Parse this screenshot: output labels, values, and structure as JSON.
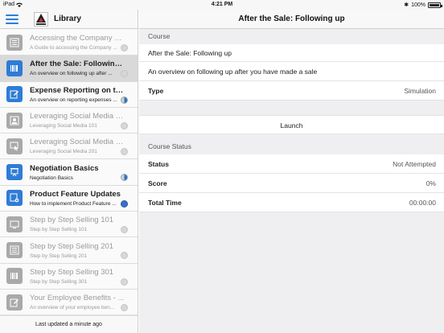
{
  "status_bar": {
    "carrier": "iPad",
    "time": "4:21 PM",
    "battery": "100%"
  },
  "sidebar": {
    "title": "Library",
    "footer": "Last updated a minute ago",
    "items": [
      {
        "title": "Accessing the Company Be...",
        "subtitle": "A Guide to accessing the Company ...",
        "icon": "document-list-icon",
        "dim": true,
        "status": "empty"
      },
      {
        "title": "After the Sale: Following up",
        "subtitle": "An overview on following up after ...",
        "icon": "barcode-icon",
        "dim": false,
        "selected": true,
        "status": "empty"
      },
      {
        "title": "Expense Reporting on the ...",
        "subtitle": "An overview on reporting expenses ...",
        "icon": "pencil-note-icon",
        "dim": false,
        "status": "half"
      },
      {
        "title": "Leveraging Social Media fo...",
        "subtitle": "Leveraging Social Media 101",
        "icon": "person-card-icon",
        "dim": true,
        "status": "empty"
      },
      {
        "title": "Leveraging Social Media fo...",
        "subtitle": "Leveraging Social Media 201",
        "icon": "cursor-screen-icon",
        "dim": true,
        "status": "empty"
      },
      {
        "title": "Negotiation Basics",
        "subtitle": "Negotiation Basics",
        "icon": "presentation-icon",
        "dim": false,
        "status": "half"
      },
      {
        "title": "Product Feature Updates",
        "subtitle": "How to implement Product Feature ...",
        "icon": "gear-doc-icon",
        "dim": false,
        "status": "full"
      },
      {
        "title": "Step by Step Selling 101",
        "subtitle": "Step by Step Selling 101",
        "icon": "screen-icon",
        "dim": true,
        "status": "empty"
      },
      {
        "title": "Step by Step Selling 201",
        "subtitle": "Step by Step Selling 201",
        "icon": "document-list-icon",
        "dim": true,
        "status": "empty"
      },
      {
        "title": "Step by Step Selling 301",
        "subtitle": "Step by Step Selling 301",
        "icon": "barcode-icon",
        "dim": true,
        "status": "empty"
      },
      {
        "title": "Your Employee Benefits - ...",
        "subtitle": "An overview of your employee ben...",
        "icon": "pencil-note-icon",
        "dim": true,
        "status": "empty"
      }
    ]
  },
  "main": {
    "title": "After the Sale: Following up",
    "course_label": "Course",
    "course_name": "After the Sale: Following up",
    "course_description": "An overview on following up after you have made a sale",
    "type_label": "Type",
    "type_value": "Simulation",
    "launch_label": "Launch",
    "status_section_label": "Course Status",
    "status_label": "Status",
    "status_value": "Not Attempted",
    "score_label": "Score",
    "score_value": "0%",
    "total_time_label": "Total Time",
    "total_time_value": "00:00:00"
  },
  "colors": {
    "accent": "#2a7fd8",
    "icon_active": "#2f7cd6",
    "icon_dim": "#a9a9a9"
  }
}
